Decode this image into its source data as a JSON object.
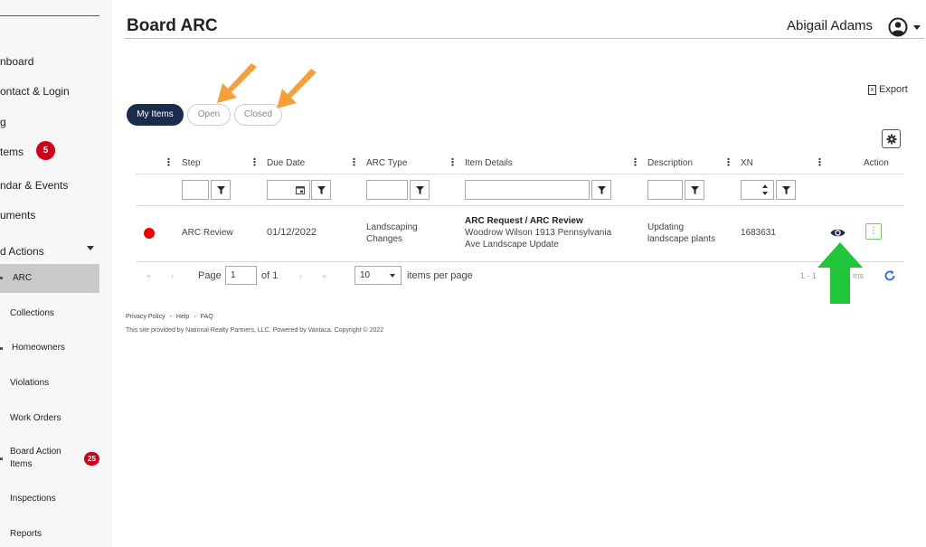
{
  "sidebar": {
    "items": [
      {
        "label": "nboard"
      },
      {
        "label": "ontact & Login"
      },
      {
        "label": "g"
      },
      {
        "label": "tems",
        "badge": "5"
      },
      {
        "label": "ndar & Events"
      },
      {
        "label": "uments"
      },
      {
        "label": "d Actions"
      }
    ],
    "subitems": [
      {
        "label": "ARC"
      },
      {
        "label": "Collections"
      },
      {
        "label": "Homeowners"
      },
      {
        "label": "Violations"
      },
      {
        "label": "Work Orders"
      },
      {
        "label": "Board Action Items",
        "badge": "25"
      },
      {
        "label": "Inspections"
      },
      {
        "label": "Reports"
      }
    ]
  },
  "header": {
    "title": "Board ARC",
    "user_name": "Abigail Adams",
    "user_icon": "user-circle-icon"
  },
  "toolbar": {
    "export_label": "Export",
    "tabs": [
      "My Items",
      "Open",
      "Closed"
    ]
  },
  "table": {
    "columns": [
      "Step",
      "Due Date",
      "ARC Type",
      "Item Details",
      "Description",
      "XN",
      "Action"
    ],
    "rows": [
      {
        "status_color": "#e00000",
        "step": "ARC Review",
        "due_date": "01/12/2022",
        "arc_type": "Landscaping Changes",
        "item_title": "ARC Request / ARC Review",
        "item_detail": "Woodrow Wilson 1913 Pennsylvania Ave Landscape Update",
        "description": "Updating landscape plants",
        "xn": "1683631"
      }
    ]
  },
  "pager": {
    "page_label": "Page",
    "page_value": "1",
    "of_label": "of 1",
    "per_page_value": "10",
    "per_page_label": "items per page",
    "range_text": "1 - 1",
    "range_suffix": "ms"
  },
  "footer": {
    "privacy": "Privacy Policy",
    "help": "Help",
    "faq": "FAQ",
    "separator": "-",
    "copyright": "This site provided by National Realty Partners, LLC. Powered by Vantaca. Copyright © 2022"
  },
  "colors": {
    "accent": "#1a2b4c",
    "badge": "#d0021b",
    "annotation_orange": "#f5a03a",
    "annotation_green": "#22c43a"
  }
}
